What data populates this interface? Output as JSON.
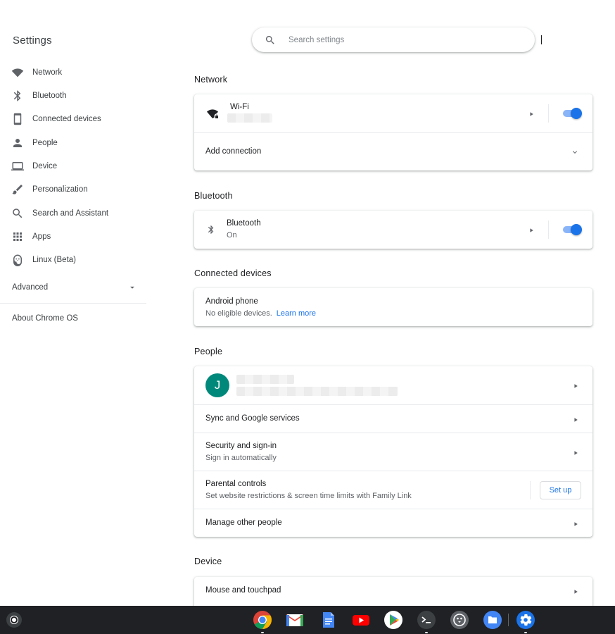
{
  "app_title": "Settings",
  "search": {
    "placeholder": "Search settings"
  },
  "sidebar": {
    "items": [
      {
        "label": "Network",
        "icon": "wifi-icon"
      },
      {
        "label": "Bluetooth",
        "icon": "bluetooth-icon"
      },
      {
        "label": "Connected devices",
        "icon": "phone-icon"
      },
      {
        "label": "People",
        "icon": "person-icon"
      },
      {
        "label": "Device",
        "icon": "laptop-icon"
      },
      {
        "label": "Personalization",
        "icon": "brush-icon"
      },
      {
        "label": "Search and Assistant",
        "icon": "search-icon"
      },
      {
        "label": "Apps",
        "icon": "apps-grid-icon"
      },
      {
        "label": "Linux (Beta)",
        "icon": "penguin-icon"
      }
    ],
    "advanced": "Advanced",
    "about": "About Chrome OS"
  },
  "network": {
    "title": "Network",
    "wifi_label": "Wi-Fi",
    "wifi_enabled": true,
    "add_connection": "Add connection"
  },
  "bluetooth": {
    "title": "Bluetooth",
    "label": "Bluetooth",
    "status": "On",
    "enabled": true
  },
  "connected_devices": {
    "title": "Connected devices",
    "android_label": "Android phone",
    "android_status": "No eligible devices.",
    "learn_more": "Learn more"
  },
  "people": {
    "title": "People",
    "avatar_initial": "J",
    "sync": "Sync and Google services",
    "security": "Security and sign-in",
    "security_sub": "Sign in automatically",
    "parental": "Parental controls",
    "parental_sub": "Set website restrictions & screen time limits with Family Link",
    "setup_button": "Set up",
    "manage": "Manage other people"
  },
  "device": {
    "title": "Device",
    "mouse": "Mouse and touchpad"
  },
  "colors": {
    "accent": "#1a73e8",
    "toggle_track": "#8ab4f8",
    "avatar": "#00897b",
    "shelf": "#202124"
  },
  "shelf": {
    "apps": [
      "chrome-icon",
      "gmail-icon",
      "docs-icon",
      "youtube-icon",
      "play-store-icon",
      "terminal-icon",
      "linux-penguin-icon",
      "files-icon",
      "settings-icon"
    ]
  }
}
